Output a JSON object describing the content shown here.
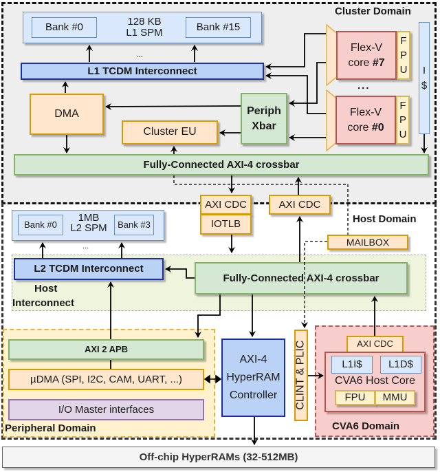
{
  "domains": {
    "cluster": "Cluster Domain",
    "host": "Host Domain",
    "peripheral": "Peripheral Domain",
    "cva6": "CVA6 Domain",
    "host_interconnect_line1": "Host",
    "host_interconnect_line2": "Interconnect"
  },
  "cluster": {
    "l1_spm": {
      "title_line1": "128 KB",
      "title_line2": "L1 SPM",
      "bank_first": "Bank #0",
      "bank_last": "Bank #15",
      "ellipsis": "..."
    },
    "l1_interconnect": "L1 TCDM Interconnect",
    "dma": "DMA",
    "cluster_eu": "Cluster EU",
    "periph_xbar_line1": "Periph",
    "periph_xbar_line2": "Xbar",
    "cores": [
      {
        "line1": "Flex-V",
        "line2_prefix": "core ",
        "line2_bold": "#7",
        "fpu": [
          "F",
          "P",
          "U"
        ]
      },
      {
        "line1": "Flex-V",
        "line2_prefix": "core ",
        "line2_bold": "#0",
        "fpu": [
          "F",
          "P",
          "U"
        ]
      }
    ],
    "cores_ellipsis": "...",
    "icache": [
      "I",
      "$"
    ],
    "axi_crossbar": "Fully-Connected AXI-4 crossbar"
  },
  "host": {
    "axi_cdc_down": "AXI CDC",
    "iotlb": "IOTLB",
    "axi_cdc_up": "AXI CDC",
    "mailbox": "MAILBOX",
    "l2_spm": {
      "title_line1": "1MB",
      "title_line2": "L2 SPM",
      "bank_first": "Bank #0",
      "bank_last": "Bank #3",
      "ellipsis": "..."
    },
    "l2_interconnect": "L2 TCDM Interconnect",
    "axi_crossbar": "Fully-Connected AXI-4 crossbar",
    "hyperram_ctrl": [
      "AXI-4",
      "HyperRAM",
      "Controller"
    ],
    "clint_plic": "CLINT & PLIC"
  },
  "peripheral": {
    "axi2apb": "AXI 2 APB",
    "udma": "µDMA (SPI, I2C, CAM, UART, ...)",
    "io_master": "I/O Master interfaces"
  },
  "cva6": {
    "axi_cdc": "AXI CDC",
    "l1i": "L1I$",
    "l1d": "L1D$",
    "core": "CVA6 Host Core",
    "fpu": "FPU",
    "mmu": "MMU"
  },
  "offchip": "Off-chip HyperRAMs (32-512MB)"
}
